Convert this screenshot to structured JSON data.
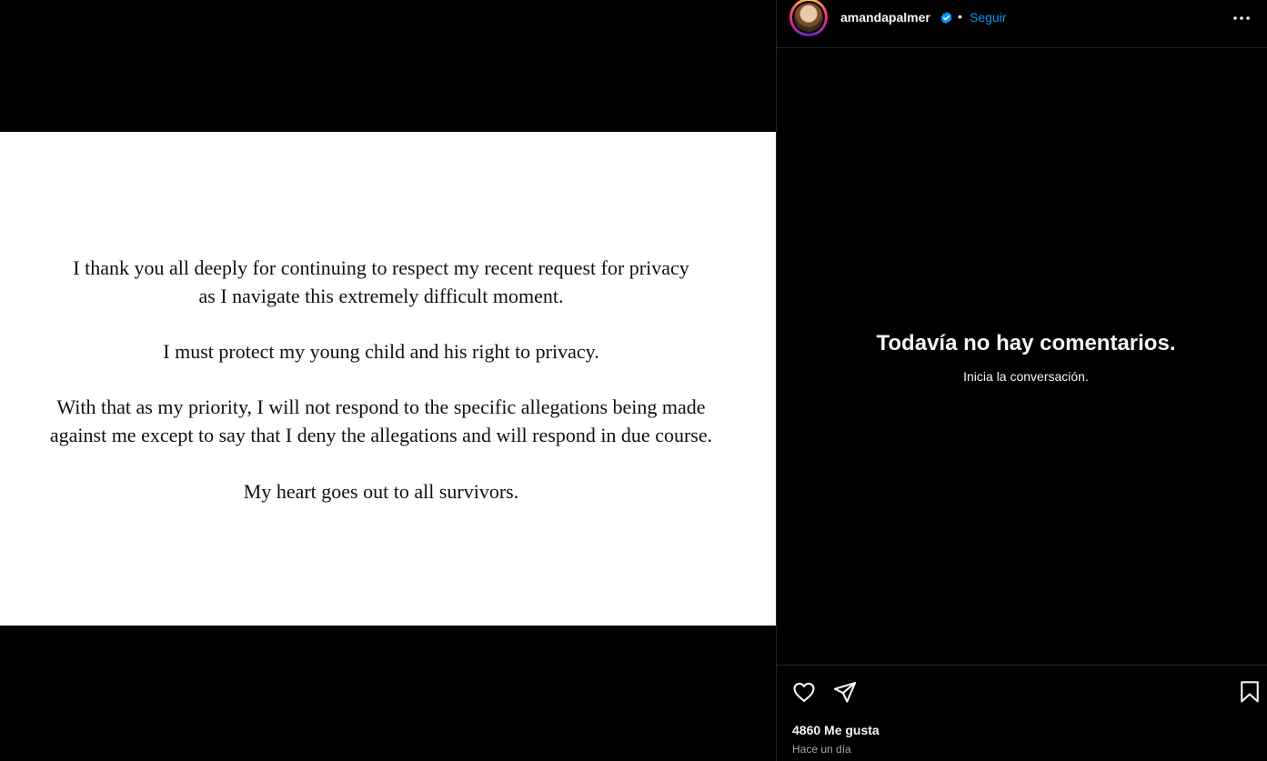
{
  "post": {
    "statement": {
      "paragraph1_line1": "I thank you all deeply for continuing to respect my recent request for privacy",
      "paragraph1_line2": "as I navigate this extremely difficult moment.",
      "paragraph2": "I must protect my young child and his right to privacy.",
      "paragraph3_line1": "With that as my priority, I will not respond to the specific allegations being made",
      "paragraph3_line2": "against me except to say that I deny the allegations and will respond in due course.",
      "paragraph4": "My heart goes out to all survivors."
    }
  },
  "header": {
    "username": "amandapalmer",
    "verified": true,
    "separator": "•",
    "follow_label": "Seguir",
    "more_icon": "more-horizontal-icon"
  },
  "comments": {
    "empty_title": "Todavía no hay comentarios.",
    "empty_subtitle": "Inicia la conversación."
  },
  "actions": {
    "like_icon": "heart-icon",
    "share_icon": "send-icon",
    "save_icon": "bookmark-icon",
    "likes_text": "4860 Me gusta",
    "timestamp": "Hace un día"
  },
  "colors": {
    "background": "#000000",
    "accent": "#0095f6",
    "verified": "#0095f6",
    "divider": "#262626",
    "muted_text": "#a8a8a8"
  }
}
